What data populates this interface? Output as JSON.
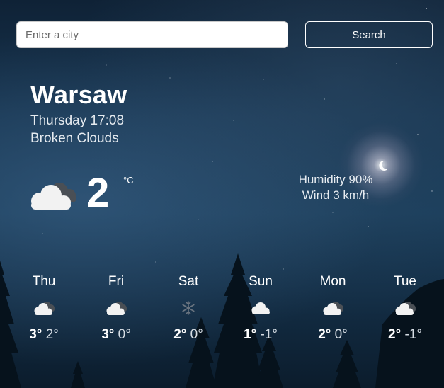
{
  "search": {
    "placeholder": "Enter a city",
    "button_label": "Search"
  },
  "current": {
    "city": "Warsaw",
    "datetime": "Thursday 17:08",
    "description": "Broken Clouds",
    "icon": "cloud-icon",
    "temperature": "2",
    "unit": "°C",
    "humidity": "Humidity 90%",
    "wind": "Wind 3 km/h"
  },
  "forecast": [
    {
      "day": "Thu",
      "icon": "cloud-icon",
      "max": "3°",
      "min": "2°"
    },
    {
      "day": "Fri",
      "icon": "cloud-icon",
      "max": "3°",
      "min": "0°"
    },
    {
      "day": "Sat",
      "icon": "snowflake-icon",
      "max": "2°",
      "min": "0°"
    },
    {
      "day": "Sun",
      "icon": "cloud-icon",
      "max": "1°",
      "min": "-1°"
    },
    {
      "day": "Mon",
      "icon": "cloud-icon",
      "max": "2°",
      "min": "0°"
    },
    {
      "day": "Tue",
      "icon": "cloud-icon",
      "max": "2°",
      "min": "-1°"
    }
  ]
}
